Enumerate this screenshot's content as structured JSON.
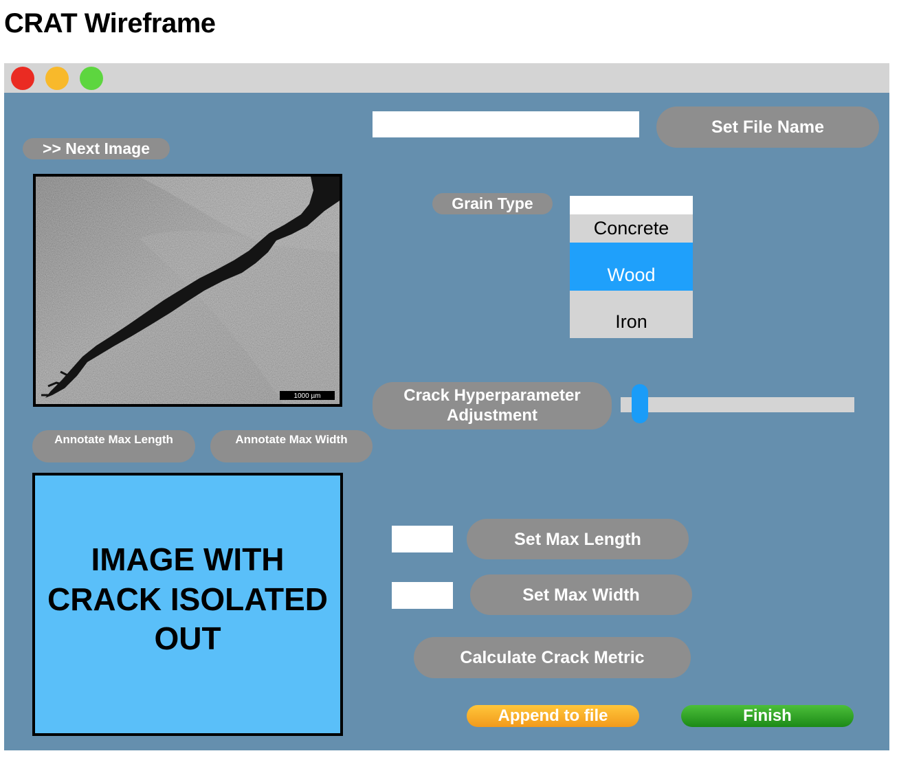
{
  "page": {
    "title": "CRAT Wireframe"
  },
  "controls": {
    "next_image": ">> Next Image",
    "file_name_value": "",
    "set_file_name": "Set File Name",
    "grain_type_label": "Grain Type",
    "grain_options": [
      "Concrete",
      "Wood",
      "Iron"
    ],
    "grain_selected": "Wood",
    "hyperparam_label": "Crack Hyperparameter Adjustment",
    "hyperparam_level": 0.05,
    "annotate_max_length": "Annotate Max Length",
    "annotate_max_width": "Annotate Max Width",
    "max_length_value": "",
    "set_max_length": "Set Max Length",
    "max_width_value": "",
    "set_max_width": "Set Max Width",
    "calculate": "Calculate Crack Metric",
    "append": "Append to file",
    "finish": "Finish"
  },
  "images": {
    "crack_scale_bar": "1000 µm",
    "result_placeholder": "IMAGE WITH CRACK ISOLATED OUT"
  },
  "colors": {
    "content_bg": "#658fae",
    "button_gray": "#8e8e8e",
    "selected_blue": "#1fa0fb",
    "result_bg": "#5abff9",
    "append_orange": "#f8a928",
    "finish_green": "#2ea52a",
    "close_red": "#ea2b22",
    "minimize_yellow": "#f8b92b",
    "zoom_green": "#5dd63f"
  },
  "icons": [
    "close-button",
    "minimize-button",
    "zoom-button"
  ]
}
